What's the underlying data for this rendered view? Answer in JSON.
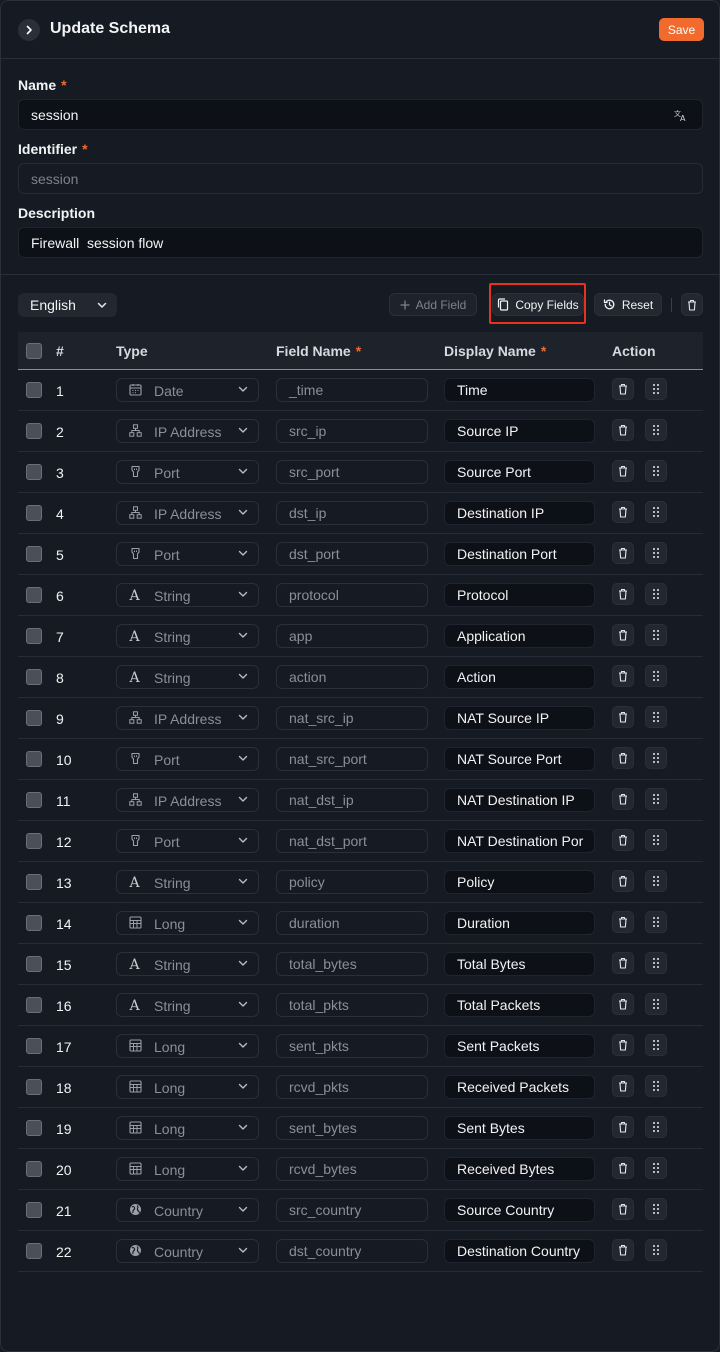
{
  "header": {
    "title": "Update Schema",
    "save_label": "Save"
  },
  "form": {
    "name": {
      "label": "Name",
      "required_mark": "*",
      "value": "session"
    },
    "identifier": {
      "label": "Identifier",
      "required_mark": "*",
      "value": "session"
    },
    "description": {
      "label": "Description",
      "value": "Firewall  session flow"
    }
  },
  "toolbar": {
    "language": "English",
    "add_field_label": "Add Field",
    "copy_fields_label": "Copy Fields",
    "reset_label": "Reset"
  },
  "table": {
    "headers": {
      "num": "#",
      "type": "Type",
      "field_name": "Field Name",
      "display_name": "Display Name",
      "action": "Action",
      "required_mark": "*"
    },
    "rows": [
      {
        "num": "1",
        "type": "Date",
        "icon": "calendar-icon",
        "field": "_time",
        "display": "Time"
      },
      {
        "num": "2",
        "type": "IP Address",
        "icon": "network-icon",
        "field": "src_ip",
        "display": "Source IP"
      },
      {
        "num": "3",
        "type": "Port",
        "icon": "port-icon",
        "field": "src_port",
        "display": "Source Port"
      },
      {
        "num": "4",
        "type": "IP Address",
        "icon": "network-icon",
        "field": "dst_ip",
        "display": "Destination IP"
      },
      {
        "num": "5",
        "type": "Port",
        "icon": "port-icon",
        "field": "dst_port",
        "display": "Destination Port"
      },
      {
        "num": "6",
        "type": "String",
        "icon": "string-icon",
        "field": "protocol",
        "display": "Protocol"
      },
      {
        "num": "7",
        "type": "String",
        "icon": "string-icon",
        "field": "app",
        "display": "Application"
      },
      {
        "num": "8",
        "type": "String",
        "icon": "string-icon",
        "field": "action",
        "display": "Action"
      },
      {
        "num": "9",
        "type": "IP Address",
        "icon": "network-icon",
        "field": "nat_src_ip",
        "display": "NAT Source IP"
      },
      {
        "num": "10",
        "type": "Port",
        "icon": "port-icon",
        "field": "nat_src_port",
        "display": "NAT Source Port"
      },
      {
        "num": "11",
        "type": "IP Address",
        "icon": "network-icon",
        "field": "nat_dst_ip",
        "display": "NAT Destination IP"
      },
      {
        "num": "12",
        "type": "Port",
        "icon": "port-icon",
        "field": "nat_dst_port",
        "display": "NAT Destination Por"
      },
      {
        "num": "13",
        "type": "String",
        "icon": "string-icon",
        "field": "policy",
        "display": "Policy"
      },
      {
        "num": "14",
        "type": "Long",
        "icon": "number-grid-icon",
        "field": "duration",
        "display": "Duration"
      },
      {
        "num": "15",
        "type": "String",
        "icon": "string-icon",
        "field": "total_bytes",
        "display": "Total Bytes"
      },
      {
        "num": "16",
        "type": "String",
        "icon": "string-icon",
        "field": "total_pkts",
        "display": "Total Packets"
      },
      {
        "num": "17",
        "type": "Long",
        "icon": "number-grid-icon",
        "field": "sent_pkts",
        "display": "Sent Packets"
      },
      {
        "num": "18",
        "type": "Long",
        "icon": "number-grid-icon",
        "field": "rcvd_pkts",
        "display": "Received Packets"
      },
      {
        "num": "19",
        "type": "Long",
        "icon": "number-grid-icon",
        "field": "sent_bytes",
        "display": "Sent Bytes"
      },
      {
        "num": "20",
        "type": "Long",
        "icon": "number-grid-icon",
        "field": "rcvd_bytes",
        "display": "Received Bytes"
      },
      {
        "num": "21",
        "type": "Country",
        "icon": "globe-icon",
        "field": "src_country",
        "display": "Source Country"
      },
      {
        "num": "22",
        "type": "Country",
        "icon": "globe-icon",
        "field": "dst_country",
        "display": "Destination Country"
      }
    ]
  },
  "colors": {
    "accent": "#f26b2e",
    "highlight_box": "#e8311f",
    "background": "#161a22"
  }
}
